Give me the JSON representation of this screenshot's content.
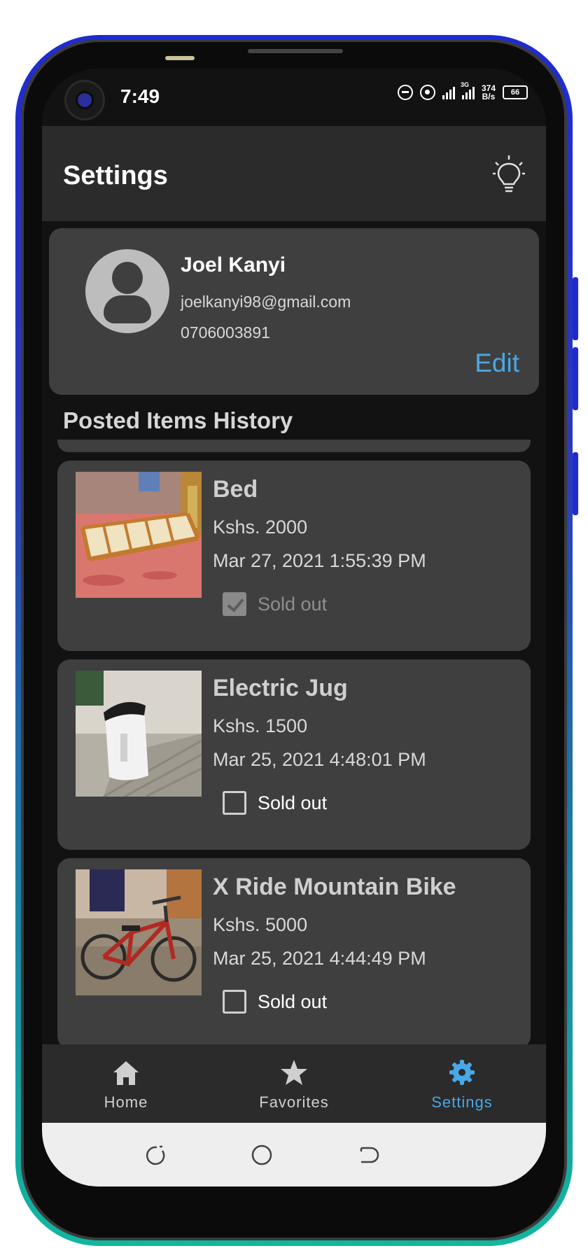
{
  "status_bar": {
    "time": "7:49",
    "net_speed_value": "374",
    "net_speed_unit": "B/s",
    "battery": "66",
    "network_type": "3G"
  },
  "app_bar": {
    "title": "Settings",
    "theme_toggle_icon": "lightbulb-icon"
  },
  "profile": {
    "name": "Joel Kanyi",
    "email": "joelkanyi98@gmail.com",
    "phone": "0706003891",
    "edit_label": "Edit",
    "avatar_icon": "person-icon"
  },
  "history": {
    "title": "Posted Items History",
    "items": [
      {
        "name": "Bed",
        "price": "Kshs. 2000",
        "date": "Mar 27, 2021 1:55:39 PM",
        "sold_label": "Sold out",
        "sold": true,
        "disabled": true
      },
      {
        "name": "Electric Jug",
        "price": "Kshs. 1500",
        "date": "Mar 25, 2021 4:48:01 PM",
        "sold_label": "Sold out",
        "sold": false,
        "disabled": false
      },
      {
        "name": "X Ride Mountain Bike",
        "price": "Kshs. 5000",
        "date": "Mar 25, 2021 4:44:49 PM",
        "sold_label": "Sold out",
        "sold": false,
        "disabled": false
      }
    ]
  },
  "bottom_nav": {
    "items": [
      {
        "label": "Home",
        "icon": "home-icon",
        "active": false
      },
      {
        "label": "Favorites",
        "icon": "star-icon",
        "active": false
      },
      {
        "label": "Settings",
        "icon": "gear-icon",
        "active": true
      }
    ]
  },
  "colors": {
    "accent": "#49a8e6",
    "background": "#121212",
    "surface": "#3f3f3f",
    "appbar": "#2b2b2b"
  }
}
